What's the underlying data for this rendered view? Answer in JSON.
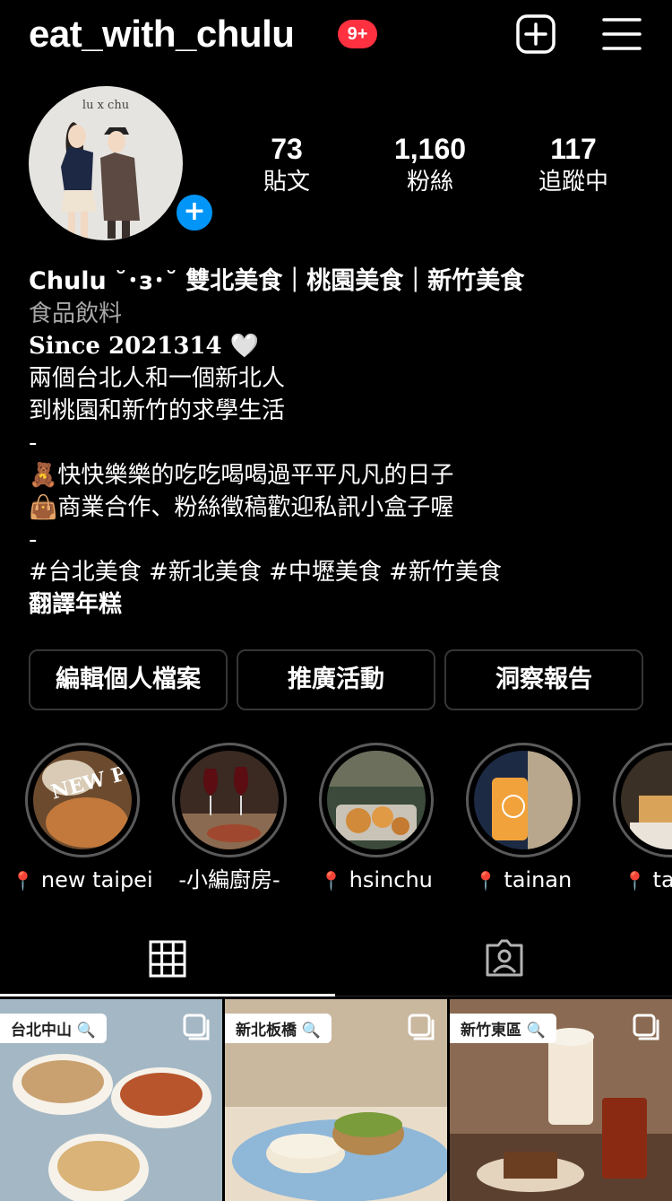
{
  "header": {
    "username": "eat_with_chulu",
    "notif_badge": "9+",
    "add_icon": "plus-square-icon",
    "menu_icon": "hamburger-menu-icon"
  },
  "profile": {
    "avatar_logo_text": "lu x chu",
    "stats": [
      {
        "value": "73",
        "label": "貼文"
      },
      {
        "value": "1,160",
        "label": "粉絲"
      },
      {
        "value": "117",
        "label": "追蹤中"
      }
    ]
  },
  "bio": {
    "name": "Chulu ˘･з･˘ 雙北美食｜桃園美食｜新竹美食",
    "category": "食品飲料",
    "since": "Since 2021314 🤍",
    "lines": [
      "兩個台北人和一個新北人",
      "到桃園和新竹的求學生活",
      "-",
      "🧸快快樂樂的吃吃喝喝過平平凡凡的日子",
      "👜商業合作、粉絲徵稿歡迎私訊小盒子喔",
      "-",
      "#台北美食 #新北美食 #中壢美食 #新竹美食"
    ],
    "translate": "翻譯年糕"
  },
  "actions": {
    "edit_profile": "編輯個人檔案",
    "promotions": "推廣活動",
    "insights": "洞察報告"
  },
  "highlights": [
    {
      "label": "new taipei",
      "pin": "📍"
    },
    {
      "label": "-小編廚房-",
      "pin": ""
    },
    {
      "label": "hsinchu",
      "pin": "📍"
    },
    {
      "label": "tainan",
      "pin": "📍"
    },
    {
      "label": "ta",
      "pin": "📍"
    }
  ],
  "tabs": {
    "grid_icon": "grid-icon",
    "tagged_icon": "tagged-person-icon"
  },
  "grid": [
    {
      "tag": "台北中山 🔍"
    },
    {
      "tag": "新北板橋 🔍"
    },
    {
      "tag": "新竹東區 🔍"
    }
  ],
  "colors": {
    "background": "#000000",
    "badge": "#ff3040",
    "accent_blue": "#0095f6",
    "muted_text": "#a8a8a8",
    "button_border": "#363636"
  }
}
